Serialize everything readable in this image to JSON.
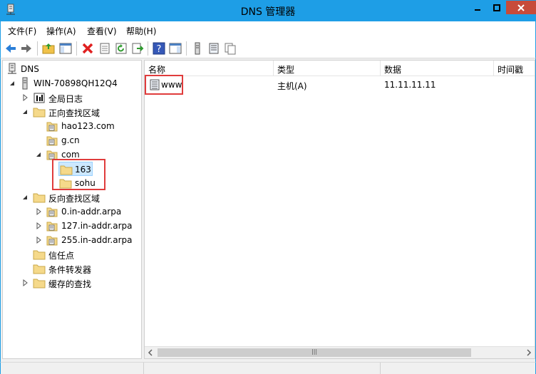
{
  "window": {
    "title": "DNS 管理器",
    "controls": [
      "minimize",
      "maximize",
      "close"
    ]
  },
  "menu": [
    {
      "label": "文件(F)"
    },
    {
      "label": "操作(A)"
    },
    {
      "label": "查看(V)"
    },
    {
      "label": "帮助(H)"
    }
  ],
  "toolbar": [
    "back-icon",
    "forward-icon",
    "up-folder-icon",
    "show-hide-tree-icon",
    "delete-icon",
    "properties-icon",
    "refresh-icon",
    "export-list-icon",
    "help-icon",
    "show-hide-action-icon",
    "server-icon",
    "records-icon",
    "copy-icon"
  ],
  "tree": {
    "root": "DNS",
    "server": "WIN-70898QH12Q4",
    "global_logs": "全局日志",
    "forward_zones": "正向查找区域",
    "zone_hao123": "hao123.com",
    "zone_gcn": "g.cn",
    "zone_com": "com",
    "zone_163": "163",
    "zone_sohu": "sohu",
    "reverse_zones": "反向查找区域",
    "rev_0": "0.in-addr.arpa",
    "rev_127": "127.in-addr.arpa",
    "rev_255": "255.in-addr.arpa",
    "trust_points": "信任点",
    "conditional_forwarders": "条件转发器",
    "cached_lookups": "缓存的查找"
  },
  "list": {
    "columns": {
      "name": "名称",
      "type": "类型",
      "data": "数据",
      "timestamp": "时间戳"
    },
    "rows": [
      {
        "name": "www",
        "type": "主机(A)",
        "data": "11.11.11.11",
        "timestamp": ""
      }
    ]
  },
  "colors": {
    "titlebar": "#1e9ee6",
    "close": "#c74b3a",
    "folder": "#f5d98a",
    "highlight": "#e03c3c",
    "selection": "#cce8ff"
  }
}
